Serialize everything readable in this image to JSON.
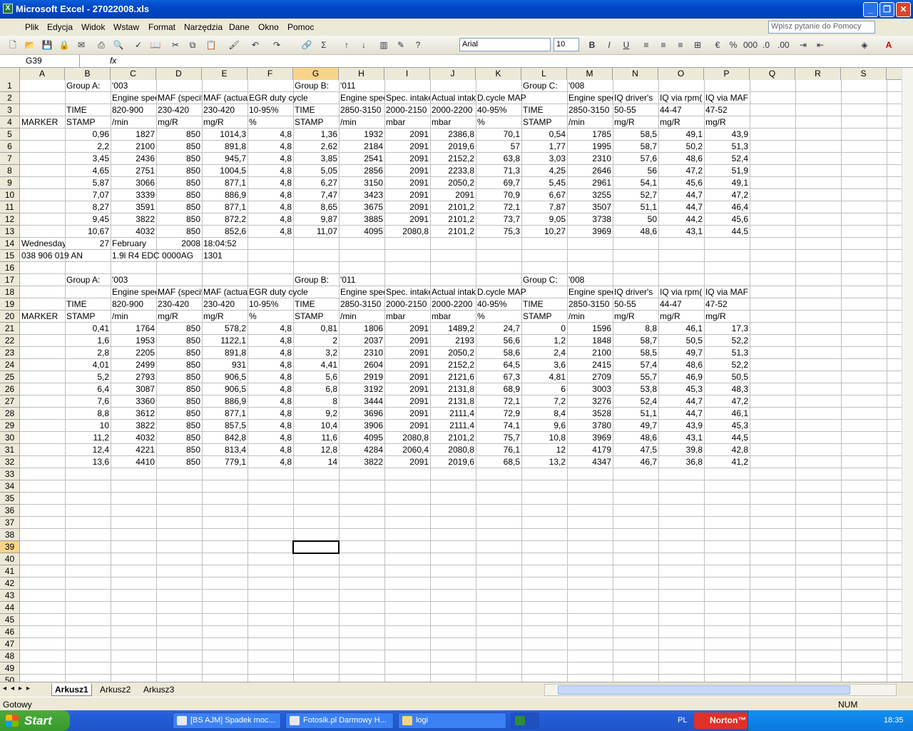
{
  "window": {
    "title": "Microsoft Excel - 27022008.xls"
  },
  "menu": [
    "Plik",
    "Edycja",
    "Widok",
    "Wstaw",
    "Format",
    "Narzędzia",
    "Dane",
    "Okno",
    "Pomoc"
  ],
  "help_placeholder": "Wpisz pytanie do Pomocy",
  "font": {
    "name": "Arial",
    "size": "10"
  },
  "namebox": "G39",
  "fx": "fx",
  "columns": [
    "A",
    "B",
    "C",
    "D",
    "E",
    "F",
    "G",
    "H",
    "I",
    "J",
    "K",
    "L",
    "M",
    "N",
    "O",
    "P",
    "Q",
    "R",
    "S"
  ],
  "row_numbers": [
    "1",
    "2",
    "3",
    "4",
    "5",
    "6",
    "7",
    "8",
    "9",
    "10",
    "11",
    "12",
    "13",
    "14",
    "15",
    "16",
    "17",
    "18",
    "19",
    "20",
    "21",
    "22",
    "23",
    "24",
    "25",
    "26",
    "27",
    "28",
    "29",
    "30",
    "31",
    "32",
    "33",
    "34",
    "35",
    "36",
    "37",
    "38",
    "39",
    "40",
    "41",
    "42",
    "43",
    "44",
    "45",
    "46",
    "47",
    "48",
    "49",
    "50"
  ],
  "selected": {
    "col": "G",
    "row": 39
  },
  "cells": [
    [
      1,
      "B",
      "Group A:",
      "l"
    ],
    [
      1,
      "C",
      "'003",
      "l"
    ],
    [
      1,
      "G",
      "Group B:",
      "l"
    ],
    [
      1,
      "H",
      "'011",
      "l"
    ],
    [
      1,
      "L",
      "Group C:",
      "l"
    ],
    [
      1,
      "M",
      "'008",
      "l"
    ],
    [
      2,
      "C",
      "Engine speed",
      "l"
    ],
    [
      2,
      "D",
      "MAF (specified)",
      "l"
    ],
    [
      2,
      "E",
      "MAF (actual)",
      "l"
    ],
    [
      2,
      "F",
      "EGR duty cycle",
      "ov"
    ],
    [
      2,
      "H",
      "Engine speed",
      "l"
    ],
    [
      2,
      "I",
      "Spec. intake",
      "l"
    ],
    [
      2,
      "J",
      "Actual intake",
      "l"
    ],
    [
      2,
      "K",
      "D.cycle MAP",
      "ov"
    ],
    [
      2,
      "M",
      "Engine speed",
      "l"
    ],
    [
      2,
      "N",
      "IQ driver's",
      "l"
    ],
    [
      2,
      "O",
      "IQ via rpm(",
      "l"
    ],
    [
      2,
      "P",
      "IQ via MAF",
      "ov"
    ],
    [
      3,
      "B",
      "TIME",
      "l"
    ],
    [
      3,
      "C",
      "820-900",
      "l"
    ],
    [
      3,
      "D",
      "230-420",
      "l"
    ],
    [
      3,
      "E",
      "230-420",
      "l"
    ],
    [
      3,
      "F",
      "10-95%",
      "l"
    ],
    [
      3,
      "G",
      "TIME",
      "l"
    ],
    [
      3,
      "H",
      "2850-3150",
      "l"
    ],
    [
      3,
      "I",
      "2000-2150",
      "l"
    ],
    [
      3,
      "J",
      "2000-2200",
      "l"
    ],
    [
      3,
      "K",
      "40-95%",
      "l"
    ],
    [
      3,
      "L",
      "TIME",
      "l"
    ],
    [
      3,
      "M",
      "2850-3150",
      "l"
    ],
    [
      3,
      "N",
      "50-55",
      "l"
    ],
    [
      3,
      "O",
      "44-47",
      "l"
    ],
    [
      3,
      "P",
      "47-52",
      "l"
    ],
    [
      4,
      "A",
      "MARKER",
      "l"
    ],
    [
      4,
      "B",
      "STAMP",
      "l"
    ],
    [
      4,
      "C",
      "/min",
      "l"
    ],
    [
      4,
      "D",
      "mg/R",
      "l"
    ],
    [
      4,
      "E",
      "mg/R",
      "l"
    ],
    [
      4,
      "F",
      "%",
      "l"
    ],
    [
      4,
      "G",
      "STAMP",
      "l"
    ],
    [
      4,
      "H",
      "/min",
      "l"
    ],
    [
      4,
      "I",
      "mbar",
      "l"
    ],
    [
      4,
      "J",
      "mbar",
      "l"
    ],
    [
      4,
      "K",
      "%",
      "l"
    ],
    [
      4,
      "L",
      "STAMP",
      "l"
    ],
    [
      4,
      "M",
      "/min",
      "l"
    ],
    [
      4,
      "N",
      "mg/R",
      "l"
    ],
    [
      4,
      "O",
      "mg/R",
      "l"
    ],
    [
      4,
      "P",
      "mg/R",
      "l"
    ],
    [
      14,
      "A",
      "Wednesday",
      "l"
    ],
    [
      14,
      "B",
      "27",
      "r"
    ],
    [
      14,
      "C",
      "February",
      "l"
    ],
    [
      14,
      "D",
      "2008",
      "r"
    ],
    [
      14,
      "E",
      "18:04:52",
      "l"
    ],
    [
      15,
      "A",
      "038 906 019 AN",
      "ov"
    ],
    [
      15,
      "C",
      "1.9l R4 EDC 0000AG",
      "ov"
    ],
    [
      15,
      "E",
      "1301",
      "l"
    ],
    [
      17,
      "B",
      "Group A:",
      "l"
    ],
    [
      17,
      "C",
      "'003",
      "l"
    ],
    [
      17,
      "G",
      "Group B:",
      "l"
    ],
    [
      17,
      "H",
      "'011",
      "l"
    ],
    [
      17,
      "L",
      "Group C:",
      "l"
    ],
    [
      17,
      "M",
      "'008",
      "l"
    ],
    [
      18,
      "C",
      "Engine speed",
      "l"
    ],
    [
      18,
      "D",
      "MAF (specified)",
      "l"
    ],
    [
      18,
      "E",
      "MAF (actual)",
      "l"
    ],
    [
      18,
      "F",
      "EGR duty cycle",
      "ov"
    ],
    [
      18,
      "H",
      "Engine speed",
      "l"
    ],
    [
      18,
      "I",
      "Spec. intake",
      "l"
    ],
    [
      18,
      "J",
      "Actual intake",
      "l"
    ],
    [
      18,
      "K",
      "D.cycle MAP",
      "ov"
    ],
    [
      18,
      "M",
      "Engine speed",
      "l"
    ],
    [
      18,
      "N",
      "IQ driver's",
      "l"
    ],
    [
      18,
      "O",
      "IQ via rpm(",
      "l"
    ],
    [
      18,
      "P",
      "IQ via MAF",
      "ov"
    ],
    [
      19,
      "B",
      "TIME",
      "l"
    ],
    [
      19,
      "C",
      "820-900",
      "l"
    ],
    [
      19,
      "D",
      "230-420",
      "l"
    ],
    [
      19,
      "E",
      "230-420",
      "l"
    ],
    [
      19,
      "F",
      "10-95%",
      "l"
    ],
    [
      19,
      "G",
      "TIME",
      "l"
    ],
    [
      19,
      "H",
      "2850-3150",
      "l"
    ],
    [
      19,
      "I",
      "2000-2150",
      "l"
    ],
    [
      19,
      "J",
      "2000-2200",
      "l"
    ],
    [
      19,
      "K",
      "40-95%",
      "l"
    ],
    [
      19,
      "L",
      "TIME",
      "l"
    ],
    [
      19,
      "M",
      "2850-3150",
      "l"
    ],
    [
      19,
      "N",
      "50-55",
      "l"
    ],
    [
      19,
      "O",
      "44-47",
      "l"
    ],
    [
      19,
      "P",
      "47-52",
      "l"
    ],
    [
      20,
      "A",
      "MARKER",
      "l"
    ],
    [
      20,
      "B",
      "STAMP",
      "l"
    ],
    [
      20,
      "C",
      "/min",
      "l"
    ],
    [
      20,
      "D",
      "mg/R",
      "l"
    ],
    [
      20,
      "E",
      "mg/R",
      "l"
    ],
    [
      20,
      "F",
      "%",
      "l"
    ],
    [
      20,
      "G",
      "STAMP",
      "l"
    ],
    [
      20,
      "H",
      "/min",
      "l"
    ],
    [
      20,
      "I",
      "mbar",
      "l"
    ],
    [
      20,
      "J",
      "mbar",
      "l"
    ],
    [
      20,
      "K",
      "%",
      "l"
    ],
    [
      20,
      "L",
      "STAMP",
      "l"
    ],
    [
      20,
      "M",
      "/min",
      "l"
    ],
    [
      20,
      "N",
      "mg/R",
      "l"
    ],
    [
      20,
      "O",
      "mg/R",
      "l"
    ],
    [
      20,
      "P",
      "mg/R",
      "l"
    ]
  ],
  "block1_rows": [
    [
      "0,96",
      "1827",
      "850",
      "1014,3",
      "4,8",
      "1,36",
      "1932",
      "2091",
      "2386,8",
      "70,1",
      "0,54",
      "1785",
      "58,5",
      "49,1",
      "43,9"
    ],
    [
      "2,2",
      "2100",
      "850",
      "891,8",
      "4,8",
      "2,62",
      "2184",
      "2091",
      "2019,6",
      "57",
      "1,77",
      "1995",
      "58,7",
      "50,2",
      "51,3"
    ],
    [
      "3,45",
      "2436",
      "850",
      "945,7",
      "4,8",
      "3,85",
      "2541",
      "2091",
      "2152,2",
      "63,8",
      "3,03",
      "2310",
      "57,6",
      "48,6",
      "52,4"
    ],
    [
      "4,65",
      "2751",
      "850",
      "1004,5",
      "4,8",
      "5,05",
      "2856",
      "2091",
      "2233,8",
      "71,3",
      "4,25",
      "2646",
      "56",
      "47,2",
      "51,9"
    ],
    [
      "5,87",
      "3066",
      "850",
      "877,1",
      "4,8",
      "6,27",
      "3150",
      "2091",
      "2050,2",
      "69,7",
      "5,45",
      "2961",
      "54,1",
      "45,6",
      "49,1"
    ],
    [
      "7,07",
      "3339",
      "850",
      "886,9",
      "4,8",
      "7,47",
      "3423",
      "2091",
      "2091",
      "70,9",
      "6,67",
      "3255",
      "52,7",
      "44,7",
      "47,2"
    ],
    [
      "8,27",
      "3591",
      "850",
      "877,1",
      "4,8",
      "8,65",
      "3675",
      "2091",
      "2101,2",
      "72,1",
      "7,87",
      "3507",
      "51,1",
      "44,7",
      "46,4"
    ],
    [
      "9,45",
      "3822",
      "850",
      "872,2",
      "4,8",
      "9,87",
      "3885",
      "2091",
      "2101,2",
      "73,7",
      "9,05",
      "3738",
      "50",
      "44,2",
      "45,6"
    ],
    [
      "10,67",
      "4032",
      "850",
      "852,6",
      "4,8",
      "11,07",
      "4095",
      "2080,8",
      "2101,2",
      "75,3",
      "10,27",
      "3969",
      "48,6",
      "43,1",
      "44,5"
    ]
  ],
  "block2_rows": [
    [
      "0,41",
      "1764",
      "850",
      "578,2",
      "4,8",
      "0,81",
      "1806",
      "2091",
      "1489,2",
      "24,7",
      "0",
      "1596",
      "8,8",
      "46,1",
      "17,3"
    ],
    [
      "1,6",
      "1953",
      "850",
      "1122,1",
      "4,8",
      "2",
      "2037",
      "2091",
      "2193",
      "56,6",
      "1,2",
      "1848",
      "58,7",
      "50,5",
      "52,2"
    ],
    [
      "2,8",
      "2205",
      "850",
      "891,8",
      "4,8",
      "3,2",
      "2310",
      "2091",
      "2050,2",
      "58,6",
      "2,4",
      "2100",
      "58,5",
      "49,7",
      "51,3"
    ],
    [
      "4,01",
      "2499",
      "850",
      "931",
      "4,8",
      "4,41",
      "2604",
      "2091",
      "2152,2",
      "64,5",
      "3,6",
      "2415",
      "57,4",
      "48,6",
      "52,2"
    ],
    [
      "5,2",
      "2793",
      "850",
      "906,5",
      "4,8",
      "5,6",
      "2919",
      "2091",
      "2121,6",
      "67,3",
      "4,81",
      "2709",
      "55,7",
      "46,9",
      "50,5"
    ],
    [
      "6,4",
      "3087",
      "850",
      "906,5",
      "4,8",
      "6,8",
      "3192",
      "2091",
      "2131,8",
      "68,9",
      "6",
      "3003",
      "53,8",
      "45,3",
      "48,3"
    ],
    [
      "7,6",
      "3360",
      "850",
      "886,9",
      "4,8",
      "8",
      "3444",
      "2091",
      "2131,8",
      "72,1",
      "7,2",
      "3276",
      "52,4",
      "44,7",
      "47,2"
    ],
    [
      "8,8",
      "3612",
      "850",
      "877,1",
      "4,8",
      "9,2",
      "3696",
      "2091",
      "2111,4",
      "72,9",
      "8,4",
      "3528",
      "51,1",
      "44,7",
      "46,1"
    ],
    [
      "10",
      "3822",
      "850",
      "857,5",
      "4,8",
      "10,4",
      "3906",
      "2091",
      "2111,4",
      "74,1",
      "9,6",
      "3780",
      "49,7",
      "43,9",
      "45,3"
    ],
    [
      "11,2",
      "4032",
      "850",
      "842,8",
      "4,8",
      "11,6",
      "4095",
      "2080,8",
      "2101,2",
      "75,7",
      "10,8",
      "3969",
      "48,6",
      "43,1",
      "44,5"
    ],
    [
      "12,4",
      "4221",
      "850",
      "813,4",
      "4,8",
      "12,8",
      "4284",
      "2060,4",
      "2080,8",
      "76,1",
      "12",
      "4179",
      "47,5",
      "39,8",
      "42,8"
    ],
    [
      "13,6",
      "4410",
      "850",
      "779,1",
      "4,8",
      "14",
      "3822",
      "2091",
      "2019,6",
      "68,5",
      "13,2",
      "4347",
      "46,7",
      "36,8",
      "41,2"
    ]
  ],
  "sheets": [
    "Arkusz1",
    "Arkusz2",
    "Arkusz3"
  ],
  "active_sheet": "Arkusz1",
  "status": {
    "left": "Gotowy",
    "num": "NUM"
  },
  "taskbar": {
    "start": "Start",
    "tasks": [
      "[BS AJM] Spadek moc...",
      "Fotosik.pl Darmowy H...",
      "logi"
    ],
    "norton": "Norton™",
    "lang": "PL",
    "clock": "18:35"
  }
}
